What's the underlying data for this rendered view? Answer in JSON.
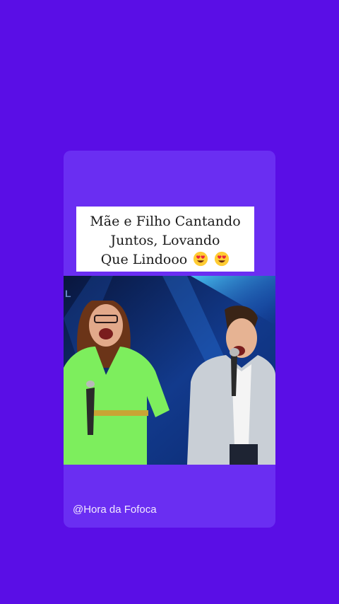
{
  "post": {
    "caption_lines": [
      "Mãe e Filho Cantando",
      "Juntos, Lovando",
      "Que Lindooo"
    ],
    "caption_emojis": [
      "heart-eyes-emoji",
      "heart-eyes-emoji"
    ],
    "watermark": "@Hora da Fofoca"
  },
  "colors": {
    "background": "#5a0ee6",
    "card": "#6a2ef2",
    "caption_bg": "#ffffff"
  }
}
